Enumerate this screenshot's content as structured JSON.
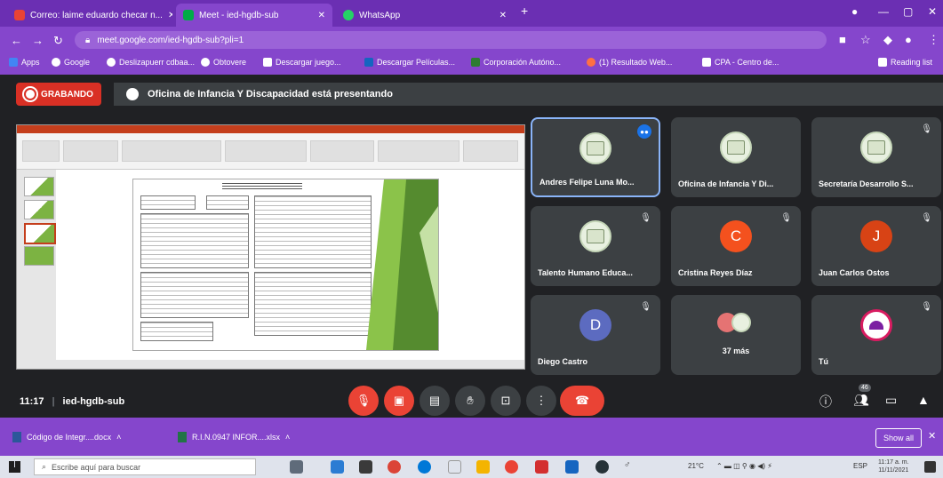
{
  "browser": {
    "tabs": [
      {
        "label": "Correo: laime eduardo checar n...",
        "active": false
      },
      {
        "label": "Meet - ied-hgdb-sub",
        "active": true
      },
      {
        "label": "WhatsApp",
        "active": false
      }
    ],
    "new_tab_label": "+",
    "url": "meet.google.com/ied-hgdb-sub?pli=1",
    "bookmarks": [
      "Apps",
      "Google",
      "Deslizapuerr cdbaa...",
      "Obtovere",
      "Descargar juego...",
      "Descargar Películas...",
      "Corporación Autóno...",
      "(1) Resultado Web...",
      "CPA - Centro de..."
    ],
    "reading_list_label": "Reading list"
  },
  "meet": {
    "recording_label": "GRABANDO",
    "presenting_text": "Oficina de Infancia Y Discapacidad está presentando",
    "participants": [
      {
        "name": "Andres Felipe Luna Mo...",
        "avatar": "logo",
        "initial": "",
        "color": "",
        "speaking": true
      },
      {
        "name": "Oficina de Infancia Y Di...",
        "avatar": "logo",
        "initial": "",
        "color": "",
        "speaking": false
      },
      {
        "name": "Secretaría Desarrollo S...",
        "avatar": "logo",
        "initial": "",
        "color": "",
        "speaking": false
      },
      {
        "name": "Talento Humano Educa...",
        "avatar": "logo",
        "initial": "",
        "color": "",
        "speaking": false
      },
      {
        "name": "Cristina Reyes Díaz",
        "avatar": "initial",
        "initial": "C",
        "color": "#f4511e",
        "speaking": false
      },
      {
        "name": "Juan Carlos Ostos",
        "avatar": "initial",
        "initial": "J",
        "color": "#d84315",
        "speaking": false
      },
      {
        "name": "Diego Castro",
        "avatar": "initial",
        "initial": "D",
        "color": "#5c6bc0",
        "speaking": false
      },
      {
        "name": "37 más",
        "avatar": "more",
        "initial": "",
        "color": "",
        "speaking": false
      },
      {
        "name": "Tú",
        "avatar": "self",
        "initial": "",
        "color": "",
        "speaking": false
      }
    ],
    "time": "11:17",
    "meeting_code": "ied-hgdb-sub",
    "people_count": "46"
  },
  "downloads": [
    {
      "label": "Código de Integr....docx"
    },
    {
      "label": "R.I.N.0947 INFOR....xlsx"
    }
  ],
  "show_all_label": "Show all",
  "taskbar": {
    "search_placeholder": "Escribe aquí para buscar",
    "weather": "21°C",
    "language": "ESP",
    "clock_time": "11:17 a. m.",
    "clock_date": "11/11/2021"
  },
  "colors": {
    "chrome_purple": "#8546cc",
    "meet_bg": "#202124",
    "tile_bg": "#3c4043",
    "record_red": "#d93025"
  }
}
